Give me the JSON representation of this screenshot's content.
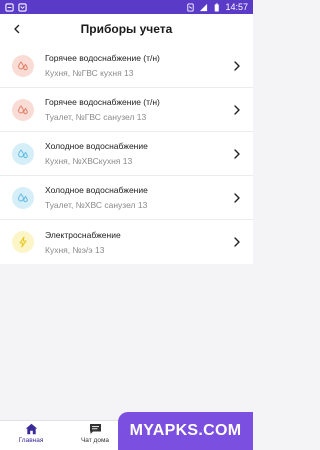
{
  "status_bar": {
    "time": "14:57"
  },
  "header": {
    "title": "Приборы учета"
  },
  "meters": [
    {
      "title": "Горячее водоснабжение (т/н)",
      "subtitle": "Кухня, №ГВС кухня 13",
      "kind": "hot-water",
      "icon": "water-drops-icon",
      "icon_bg": "#f9dcd6",
      "icon_color": "#e07a62"
    },
    {
      "title": "Горячее водоснабжение (т/н)",
      "subtitle": "Туалет, №ГВС санузел 13",
      "kind": "hot-water",
      "icon": "water-drops-icon",
      "icon_bg": "#f9dcd6",
      "icon_color": "#e07a62"
    },
    {
      "title": "Холодное водоснабжение",
      "subtitle": "Кухня, №ХВСкухня 13",
      "kind": "cold-water",
      "icon": "water-drops-icon",
      "icon_bg": "#d6eef8",
      "icon_color": "#5bb8e2"
    },
    {
      "title": "Холодное водоснабжение",
      "subtitle": "Туалет, №ХВС санузел 13",
      "kind": "cold-water",
      "icon": "water-drops-icon",
      "icon_bg": "#d6eef8",
      "icon_color": "#5bb8e2"
    },
    {
      "title": "Электроснабжение",
      "subtitle": "Кухня, №э/э 13",
      "kind": "electricity",
      "icon": "lightning-icon",
      "icon_bg": "#fbf5c8",
      "icon_color": "#e8c81c"
    }
  ],
  "bottom_nav": {
    "tabs": [
      {
        "label": "Главная",
        "icon": "home-icon",
        "active": true
      },
      {
        "label": "Чат дома",
        "icon": "chat-icon",
        "active": false
      }
    ]
  },
  "watermark": "MYAPKS.COM",
  "colors": {
    "status_bar": "#5a3bc8",
    "accent": "#3a2a9a",
    "watermark_bg": "#7b4fe0"
  }
}
